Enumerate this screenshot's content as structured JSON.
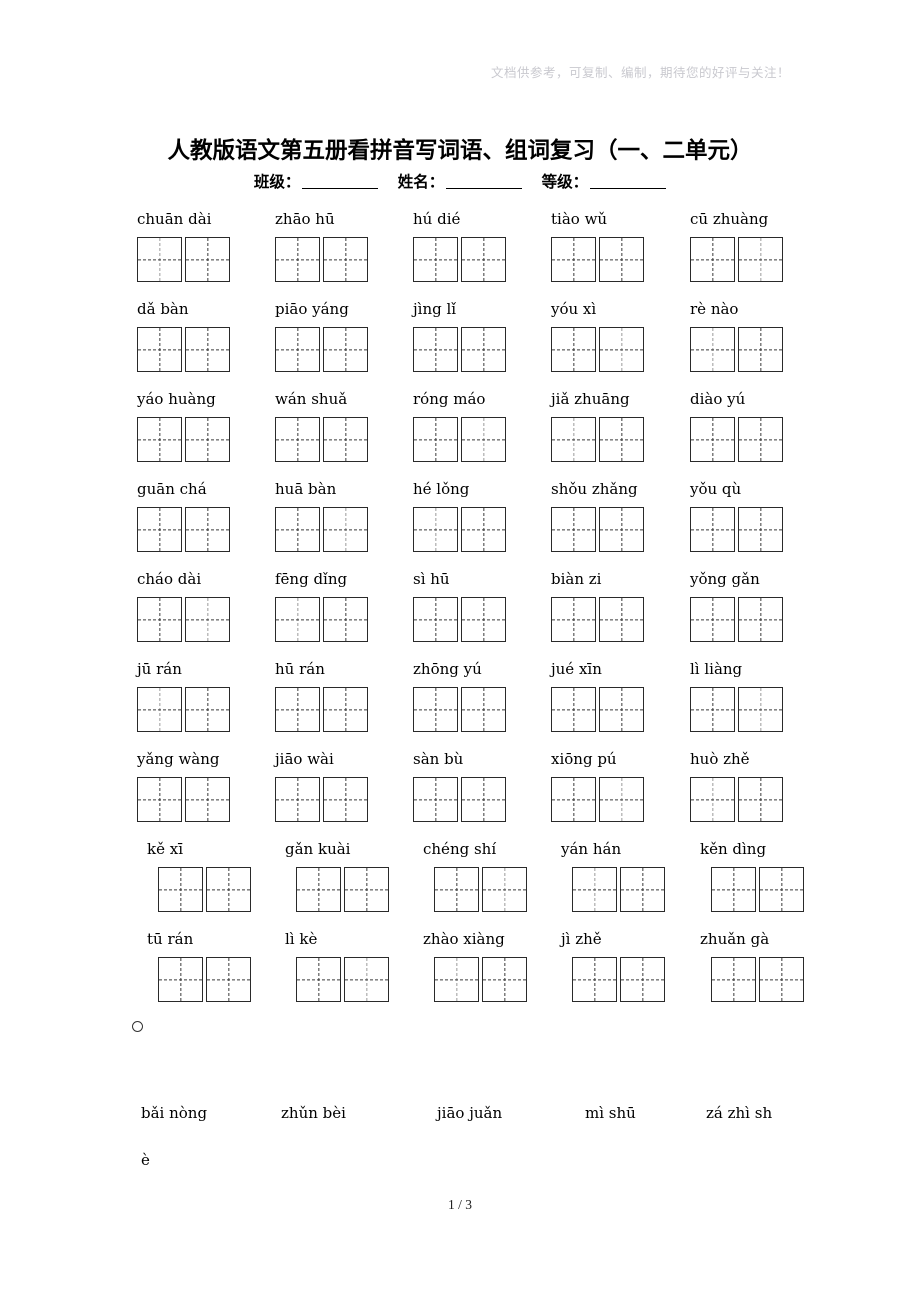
{
  "watermark": "文档供参考，可复制、编制，期待您的好评与关注！",
  "title": "人教版语文第五册看拼音写词语、组词复习（一、二单元）",
  "info": {
    "class_label": "班级：",
    "name_label": "姓名：",
    "grade_label": "等级："
  },
  "sheet": {
    "rows": [
      {
        "indent": false,
        "items": [
          {
            "pinyin": "chuān dài",
            "cells": 2
          },
          {
            "pinyin": "zhāo hū",
            "cells": 2
          },
          {
            "pinyin": "hú dié",
            "cells": 2
          },
          {
            "pinyin": "tiào wǔ",
            "cells": 2
          },
          {
            "pinyin": "cū zhuàng",
            "cells": 2
          }
        ]
      },
      {
        "indent": false,
        "items": [
          {
            "pinyin": "dǎ bàn",
            "cells": 2
          },
          {
            "pinyin": "piāo yáng",
            "cells": 2
          },
          {
            "pinyin": "jìng lǐ",
            "cells": 2
          },
          {
            "pinyin": "yóu xì",
            "cells": 2
          },
          {
            "pinyin": "rè nào",
            "cells": 2
          }
        ]
      },
      {
        "indent": false,
        "items": [
          {
            "pinyin": "yáo huàng",
            "cells": 2
          },
          {
            "pinyin": "wán shuǎ",
            "cells": 2
          },
          {
            "pinyin": "róng máo",
            "cells": 2
          },
          {
            "pinyin": "jiǎ zhuāng",
            "cells": 2
          },
          {
            "pinyin": "diào yú",
            "cells": 2
          }
        ]
      },
      {
        "indent": false,
        "items": [
          {
            "pinyin": "guān chá",
            "cells": 2
          },
          {
            "pinyin": "huā bàn",
            "cells": 2
          },
          {
            "pinyin": "hé lǒng",
            "cells": 2
          },
          {
            "pinyin": "shǒu zhǎng",
            "cells": 2
          },
          {
            "pinyin": "yǒu qù",
            "cells": 2
          }
        ]
      },
      {
        "indent": false,
        "items": [
          {
            "pinyin": "cháo dài",
            "cells": 2
          },
          {
            "pinyin": "fēng dǐng",
            "cells": 2
          },
          {
            "pinyin": "sì hū",
            "cells": 2
          },
          {
            "pinyin": "biàn zi",
            "cells": 2
          },
          {
            "pinyin": "yǒng gǎn",
            "cells": 2
          }
        ]
      },
      {
        "indent": false,
        "items": [
          {
            "pinyin": "jū rán",
            "cells": 2
          },
          {
            "pinyin": "hū rán",
            "cells": 2
          },
          {
            "pinyin": "zhōng yú",
            "cells": 2
          },
          {
            "pinyin": "jué xīn",
            "cells": 2
          },
          {
            "pinyin": "lì liàng",
            "cells": 2
          }
        ]
      },
      {
        "indent": false,
        "items": [
          {
            "pinyin": "yǎng wàng",
            "cells": 2
          },
          {
            "pinyin": "jiāo wài",
            "cells": 2
          },
          {
            "pinyin": "sàn bù",
            "cells": 2
          },
          {
            "pinyin": "xiōng pú",
            "cells": 2
          },
          {
            "pinyin": "huò zhě",
            "cells": 2
          }
        ]
      },
      {
        "indent": true,
        "items": [
          {
            "pinyin": "kě xī",
            "cells": 2
          },
          {
            "pinyin": "gǎn kuài",
            "cells": 2
          },
          {
            "pinyin": "chéng shí",
            "cells": 2
          },
          {
            "pinyin": "yán hán",
            "cells": 2
          },
          {
            "pinyin": "kěn dìng",
            "cells": 2
          }
        ]
      },
      {
        "indent": true,
        "items": [
          {
            "pinyin": "tū rán",
            "cells": 2
          },
          {
            "pinyin": "lì kè",
            "cells": 2
          },
          {
            "pinyin": "zhào xiàng",
            "cells": 2
          },
          {
            "pinyin": "jì zhě",
            "cells": 2
          },
          {
            "pinyin": "zhuǎn gà",
            "cells": 2
          }
        ]
      }
    ]
  },
  "tail": {
    "items": [
      "bǎi nòng",
      "zhǔn bèi",
      "jiāo juǎn",
      "mì shū",
      "zá zhì sh"
    ],
    "wrapped": "è"
  },
  "footer": "1 / 3"
}
